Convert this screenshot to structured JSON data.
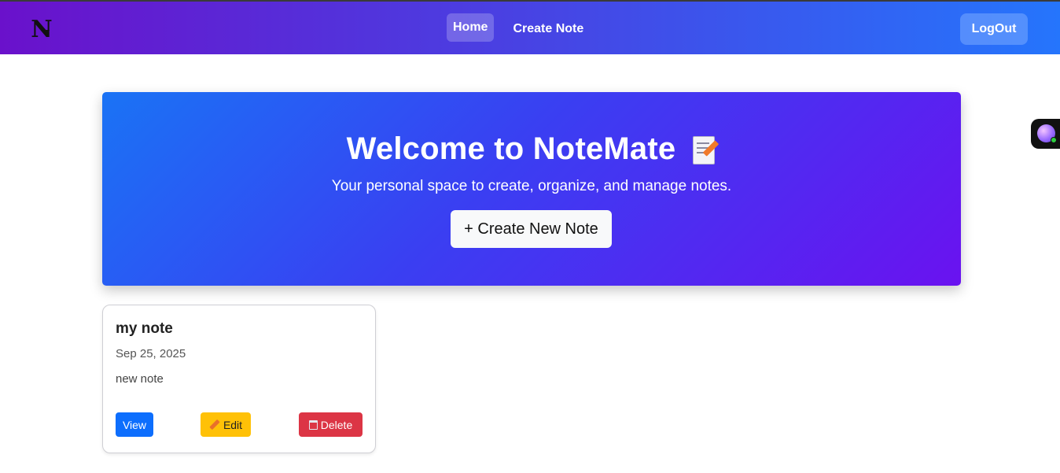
{
  "nav": {
    "logo_letter": "N",
    "links": [
      {
        "label": "Home",
        "active": true
      },
      {
        "label": "Create Note",
        "active": false
      }
    ],
    "logout_label": "LogOut"
  },
  "hero": {
    "title": "Welcome to NoteMate",
    "title_icon": "memo-icon",
    "subtitle": "Your personal space to create, organize, and manage notes.",
    "cta_label": "+ Create New Note"
  },
  "notes": [
    {
      "title": "my note",
      "date": "Sep 25, 2025",
      "body": "new note",
      "view_label": "View",
      "edit_label": "Edit",
      "delete_label": "Delete"
    }
  ],
  "colors": {
    "nav_gradient": [
      "#6a11cb",
      "#2575fc"
    ],
    "hero_gradient": [
      "#1a73f5",
      "#6a12f0"
    ],
    "view": "#0d6efd",
    "edit": "#ffc107",
    "delete": "#dc3545"
  }
}
